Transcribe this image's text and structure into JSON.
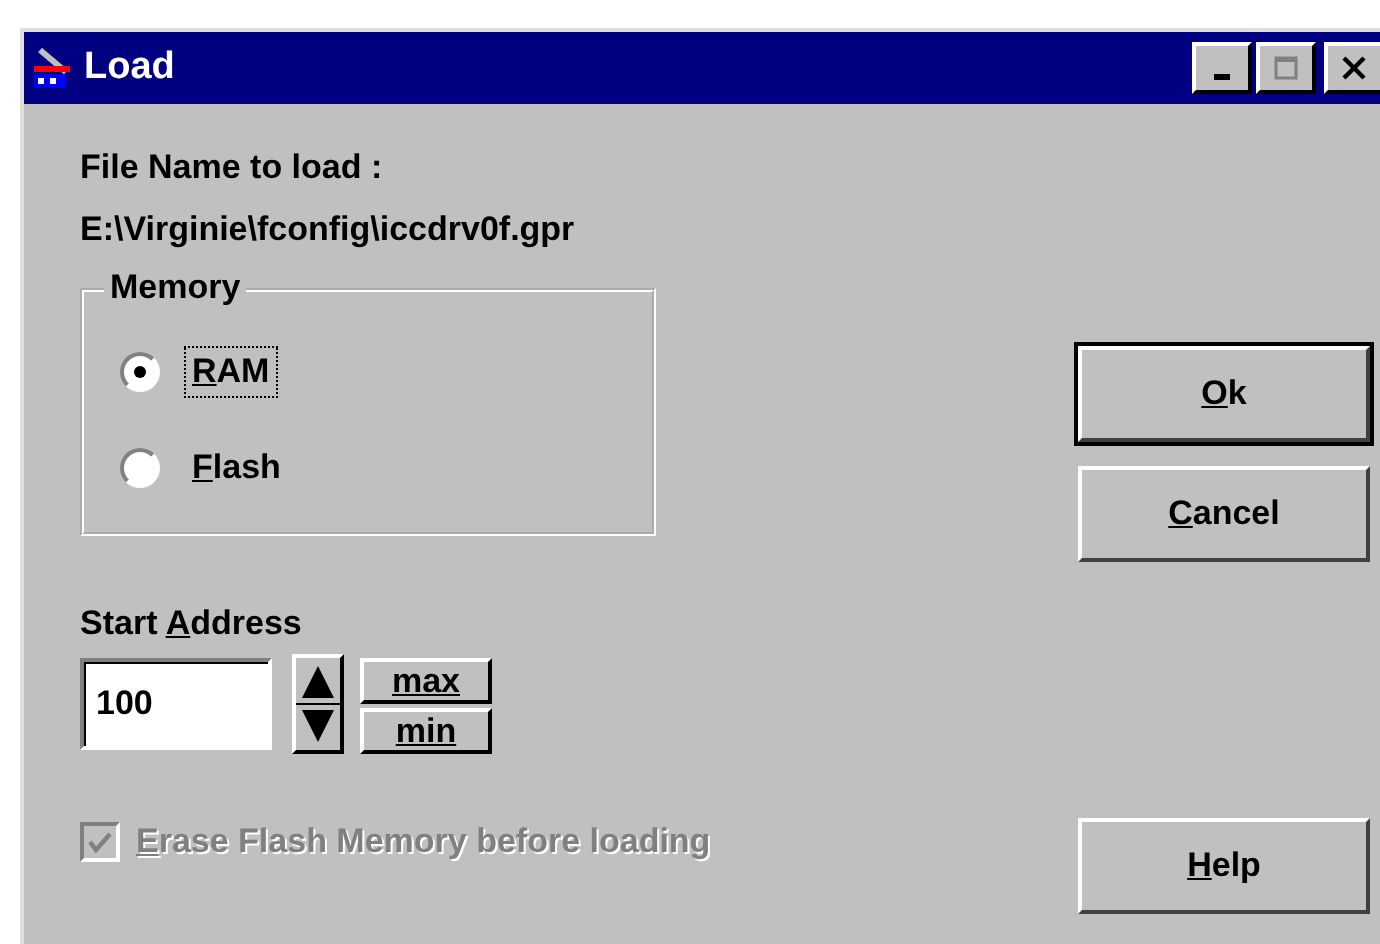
{
  "window": {
    "title": "Load",
    "controls": [
      {
        "kind": "minimize",
        "disabled": false
      },
      {
        "kind": "maximize",
        "disabled": true
      },
      {
        "kind": "close",
        "disabled": false
      }
    ]
  },
  "file_label": "File Name to load :",
  "file_path": "E:\\Virginie\\fconfig\\iccdrv0f.gpr",
  "memory": {
    "title": "Memory",
    "options": [
      {
        "key": "R",
        "post": "AM",
        "selected": true,
        "focused": true
      },
      {
        "key": "F",
        "post": "lash",
        "selected": false,
        "focused": false
      }
    ]
  },
  "start_address": {
    "pre": "Start ",
    "key": "A",
    "post": "ddress",
    "value": "100",
    "buttons": [
      "max",
      "min"
    ]
  },
  "erase": {
    "key": "E",
    "post": "rase Flash Memory before loading",
    "checked": true,
    "disabled": true
  },
  "buttons": [
    {
      "key": "O",
      "post": "k",
      "default": true,
      "spacer": false
    },
    {
      "key": "C",
      "post": "ancel",
      "default": false,
      "spacer": false
    },
    {
      "key": "H",
      "post": "elp",
      "default": false,
      "spacer": true
    }
  ]
}
